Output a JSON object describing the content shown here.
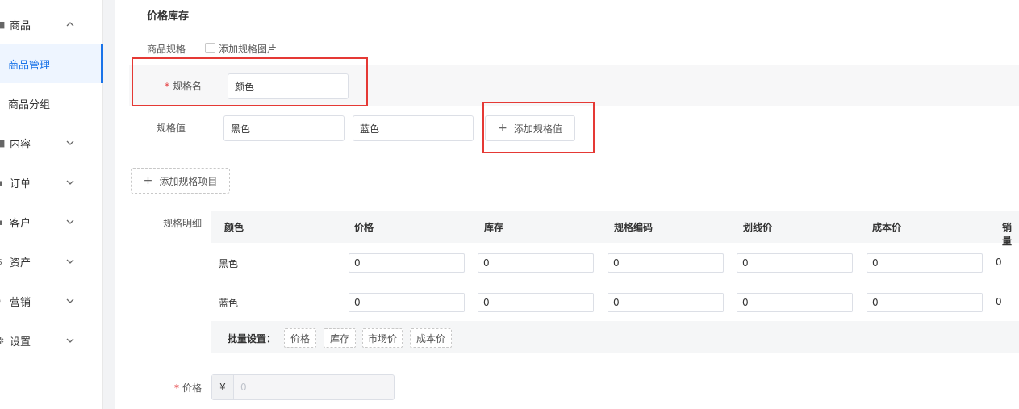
{
  "sidebar": {
    "items": [
      {
        "label": "商品",
        "icon": "goods-icon"
      },
      {
        "label": "内容",
        "icon": "content-icon"
      },
      {
        "label": "订单",
        "icon": "order-icon"
      },
      {
        "label": "客户",
        "icon": "customer-icon"
      },
      {
        "label": "资产",
        "icon": "asset-icon"
      },
      {
        "label": "营销",
        "icon": "marketing-icon"
      },
      {
        "label": "设置",
        "icon": "settings-icon"
      }
    ],
    "subitems": [
      {
        "label": "商品管理",
        "active": true
      },
      {
        "label": "商品分组",
        "active": false
      }
    ]
  },
  "main": {
    "section_title": "价格库存",
    "spec_label": "商品规格",
    "add_spec_image_label": "添加规格图片",
    "spec_name_label": "规格名",
    "spec_name_value": "颜色",
    "spec_value_label": "规格值",
    "spec_values": [
      "黑色",
      "蓝色"
    ],
    "add_spec_value_button": "添加规格值",
    "add_spec_item_button": "添加规格项目",
    "detail_label": "规格明细",
    "table": {
      "headers": [
        "颜色",
        "价格",
        "库存",
        "规格编码",
        "划线价",
        "成本价",
        "销量"
      ],
      "rows": [
        {
          "name": "黑色",
          "price": "0",
          "stock": "0",
          "code": "0",
          "strike": "0",
          "cost": "0",
          "sales": "0"
        },
        {
          "name": "蓝色",
          "price": "0",
          "stock": "0",
          "code": "0",
          "strike": "0",
          "cost": "0",
          "sales": "0"
        }
      ]
    },
    "batch_label": "批量设置：",
    "batch_tags": [
      "价格",
      "库存",
      "市场价",
      "成本价"
    ],
    "price_label": "价格",
    "price_prefix": "¥",
    "price_placeholder": "0",
    "required_mark": "*",
    "plus_glyph": "+"
  },
  "colors": {
    "accent": "#1a73e8",
    "highlight_border": "#e53935",
    "required": "#e4393c"
  }
}
